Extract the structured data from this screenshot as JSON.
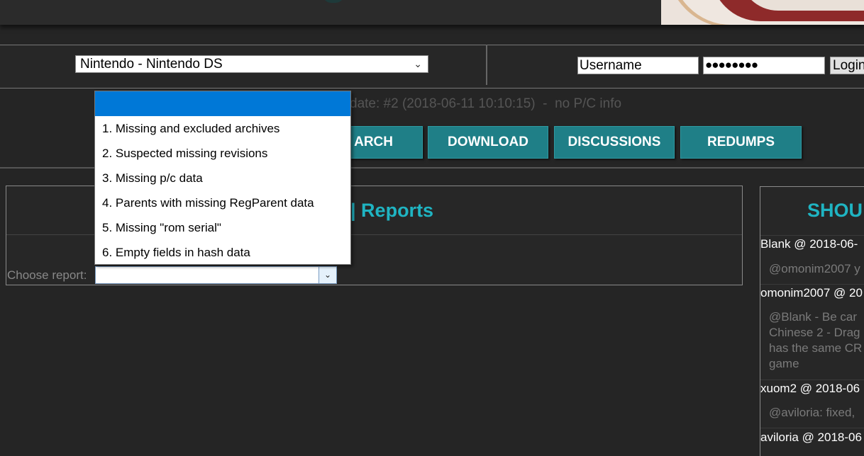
{
  "header": {
    "system_select_value": "Nintendo - Nintendo DS",
    "username_placeholder": "Username",
    "password_mask": "●●●●●●●●",
    "login_label": "Login"
  },
  "status": {
    "text": "date: #2 (2018-06-11 10:10:15)  -  no P/C info"
  },
  "nav": {
    "search": "ARCH",
    "download": "DOWNLOAD",
    "discussions": "DISCUSSIONS",
    "redumps": "REDUMPS"
  },
  "reports": {
    "title": "| Reports",
    "choose_label": "Choose report:",
    "options": [
      "",
      "1. Missing and excluded archives",
      "2. Suspected missing revisions",
      "3. Missing p/c data",
      "4. Parents with missing RegParent data",
      "5. Missing \"rom serial\"",
      "6. Empty fields in hash data"
    ]
  },
  "shoutbox": {
    "title": "SHOU",
    "posts": [
      {
        "head": "Blank @ 2018-06-",
        "msg": "@omonim2007 y"
      },
      {
        "head": "omonim2007 @ 20",
        "msg": "@Blank - Be car\nChinese 2 - Drag\nhas the same CR\ngame"
      },
      {
        "head": "xuom2 @ 2018-06",
        "msg": "@aviloria: fixed,"
      },
      {
        "head": "aviloria @ 2018-06",
        "msg": ""
      }
    ]
  },
  "colors": {
    "accent": "#1fb4c2",
    "nav_button": "#1f7f87",
    "selection": "#0078d7",
    "background": "#252525"
  }
}
